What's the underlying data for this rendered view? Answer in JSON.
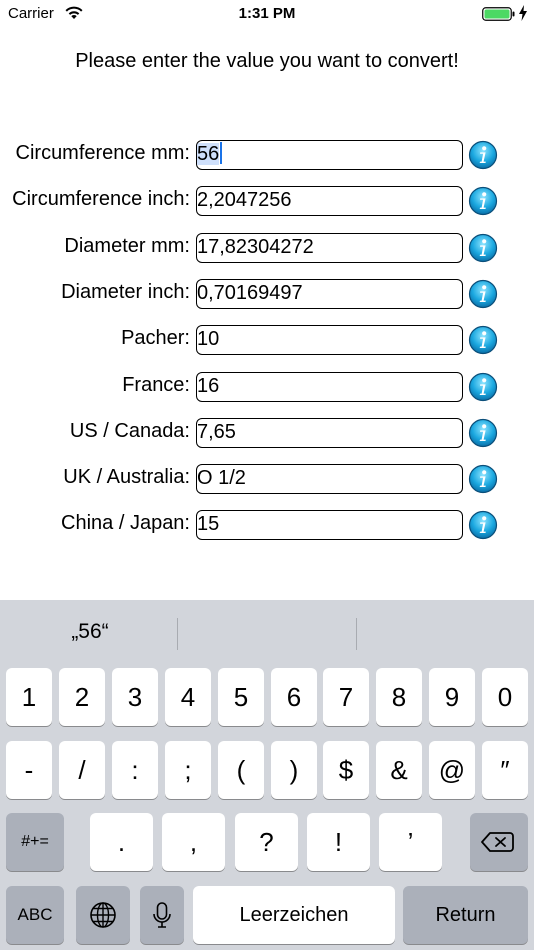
{
  "status_bar": {
    "carrier": "Carrier",
    "time": "1:31 PM",
    "battery_color": "#4cd964"
  },
  "prompt": "Please enter the value you want to convert!",
  "rows": [
    {
      "label": "Circumference mm:",
      "value": "56"
    },
    {
      "label": "Circumference inch:",
      "value": "2,2047256"
    },
    {
      "label": "Diameter mm:",
      "value": "17,82304272"
    },
    {
      "label": "Diameter inch:",
      "value": "0,70169497"
    },
    {
      "label": "Pacher:",
      "value": "10"
    },
    {
      "label": "France:",
      "value": "16"
    },
    {
      "label": "US / Canada:",
      "value": "7,65"
    },
    {
      "label": "UK / Australia:",
      "value": "O 1/2"
    },
    {
      "label": "China / Japan:",
      "value": "15"
    }
  ],
  "info_icon_color": "#1ba8e0",
  "keyboard": {
    "suggestion": "„56“",
    "row1": [
      "1",
      "2",
      "3",
      "4",
      "5",
      "6",
      "7",
      "8",
      "9",
      "0"
    ],
    "row2": [
      "-",
      "/",
      ":",
      ";",
      "(",
      ")",
      "$",
      "&",
      "@",
      "″"
    ],
    "row3_left": "#+=",
    "row3": [
      ".",
      ",",
      "?",
      "!",
      "’"
    ],
    "abc": "ABC",
    "space": "Leerzeichen",
    "return": "Return"
  }
}
